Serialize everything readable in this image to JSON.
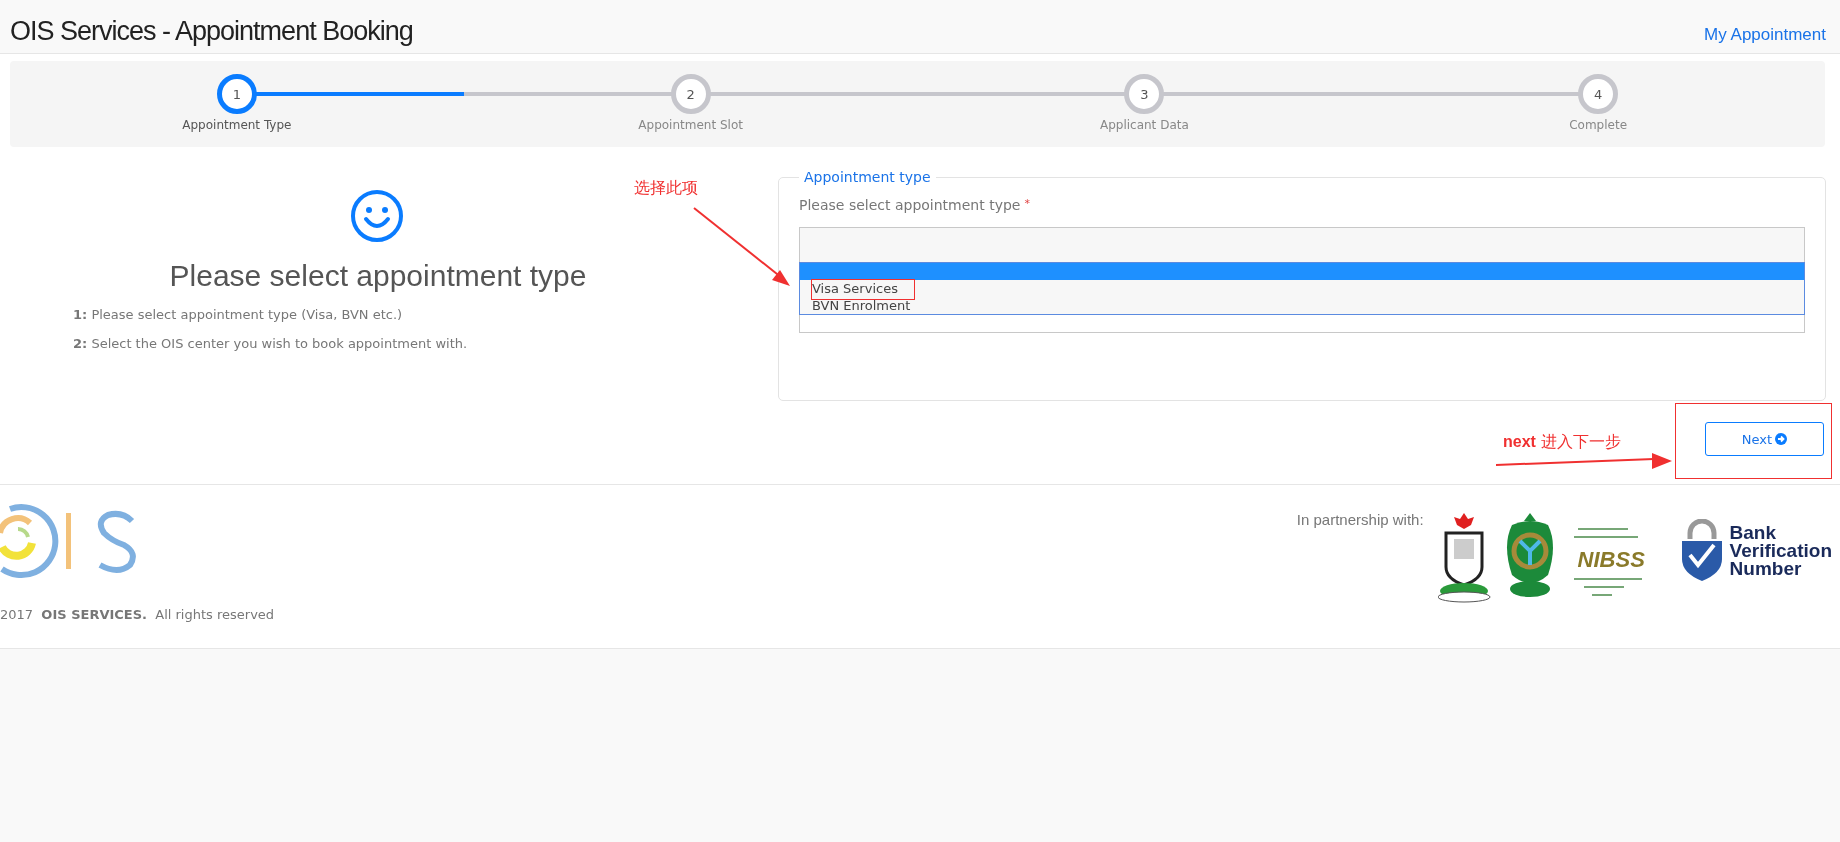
{
  "header": {
    "title": "OIS Services - Appointment Booking",
    "link": "My Appointment"
  },
  "steps": [
    {
      "number": "1",
      "label": "Appointment Type",
      "current": true
    },
    {
      "number": "2",
      "label": "Appointment Slot",
      "current": false
    },
    {
      "number": "3",
      "label": "Applicant Data",
      "current": false
    },
    {
      "number": "4",
      "label": "Complete",
      "current": false
    }
  ],
  "intro": {
    "heading": "Please select appointment type",
    "notes": [
      {
        "marker": "1:",
        "text": "Please select appointment type (Visa, BVN etc.)"
      },
      {
        "marker": "2:",
        "text": "Select the OIS center you wish to book appointment with."
      }
    ]
  },
  "form": {
    "legend": "Appointment type",
    "label": "Please select appointment type",
    "required_mark": "*",
    "options": [
      {
        "kind": "blank",
        "selected": true
      },
      {
        "kind": "option",
        "label": "Visa Services",
        "selected": false
      },
      {
        "kind": "option",
        "label": "BVN Enrolment",
        "selected": false
      }
    ]
  },
  "next_button": {
    "label": "Next"
  },
  "annotations": {
    "select_note": "选择此项",
    "next_note": "**next** 进入下一步"
  },
  "footer": {
    "year": "2017",
    "company": "OIS SERVICES.",
    "rights": "All rights reserved",
    "partners_label": "In partnership with:",
    "nibss_text": "NIBSS",
    "bvn_lines": [
      "Bank",
      "Verification",
      "Number"
    ]
  }
}
